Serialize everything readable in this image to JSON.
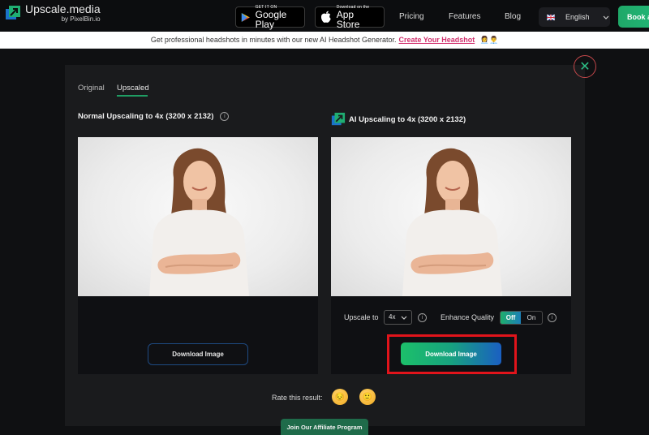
{
  "header": {
    "logo_title": "Upscale.media",
    "logo_sub": "by PixelBin.io",
    "google_play": {
      "small": "GET IT ON",
      "big": "Google Play"
    },
    "app_store": {
      "small": "Download on the",
      "big": "App Store"
    },
    "nav": [
      "Pricing",
      "Features",
      "Blog"
    ],
    "language": "English",
    "cta": "Book a"
  },
  "promo": {
    "text": "Get professional headshots in minutes with our new AI Headshot Generator.",
    "link": "Create Your Headshot",
    "icons": "👩‍💼👨‍💼"
  },
  "modal": {
    "close_glyph": "✕",
    "tabs": [
      {
        "label": "Original",
        "active": false
      },
      {
        "label": "Upscaled",
        "active": true
      }
    ],
    "left_panel": {
      "title": "Normal Upscaling to 4x (3200 x 2132)",
      "info_glyph": "i",
      "download_label": "Download Image"
    },
    "right_panel": {
      "title": "AI Upscaling to 4x (3200 x 2132)",
      "upscale_label": "Upscale to",
      "upscale_value": "4x",
      "enhance_label": "Enhance Quality",
      "toggle_off": "Off",
      "toggle_on": "On",
      "toggle_state": "Off",
      "info_glyph": "i",
      "download_label": "Download Image"
    },
    "rating": {
      "label": "Rate this result:",
      "emojis": [
        "😔",
        "🙂"
      ]
    },
    "affiliate_label": "Join Our Affiliate Program"
  },
  "colors": {
    "accent_green": "#1fa868",
    "highlight_red": "#e1141b",
    "promo_link": "#d1306d"
  }
}
